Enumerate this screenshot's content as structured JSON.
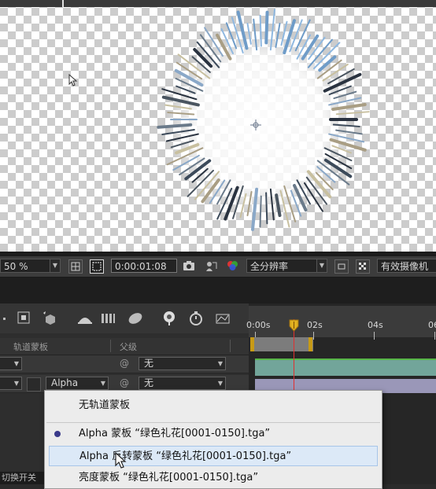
{
  "viewer_bar": {
    "zoom_value": "50 %",
    "timecode": "0:00:01:08",
    "resolution_value": "全分辨率",
    "camera_value": "有效摄像机"
  },
  "layers_header": {
    "track_matte_col": "轨道蒙板",
    "parent_col": "父级"
  },
  "layers": [
    {
      "matte_value": "",
      "parent_value": "无"
    },
    {
      "matte_value": "Alpha",
      "parent_value": "无"
    }
  ],
  "timeline": {
    "ticks": [
      "0:00s",
      "02s",
      "04s",
      "06"
    ]
  },
  "context_menu": {
    "items": [
      {
        "label": "无轨道蒙板",
        "selected": false,
        "highlighted": false
      },
      {
        "label": "Alpha 蒙板 “绿色礼花[0001-0150].tga”",
        "selected": true,
        "highlighted": false
      },
      {
        "label": "Alpha 反转蒙板 “绿色礼花[0001-0150].tga”",
        "selected": false,
        "highlighted": true
      },
      {
        "label": "亮度蒙板 “绿色礼花[0001-0150].tga”",
        "selected": false,
        "highlighted": false
      }
    ]
  },
  "status": {
    "toggle_label": "切换开关"
  },
  "colors": {
    "green_layer_bar": "#72a59a",
    "purple_layer_bar": "#9a97b8",
    "playhead": "#e03030",
    "work_area_handle": "#c79a16"
  }
}
